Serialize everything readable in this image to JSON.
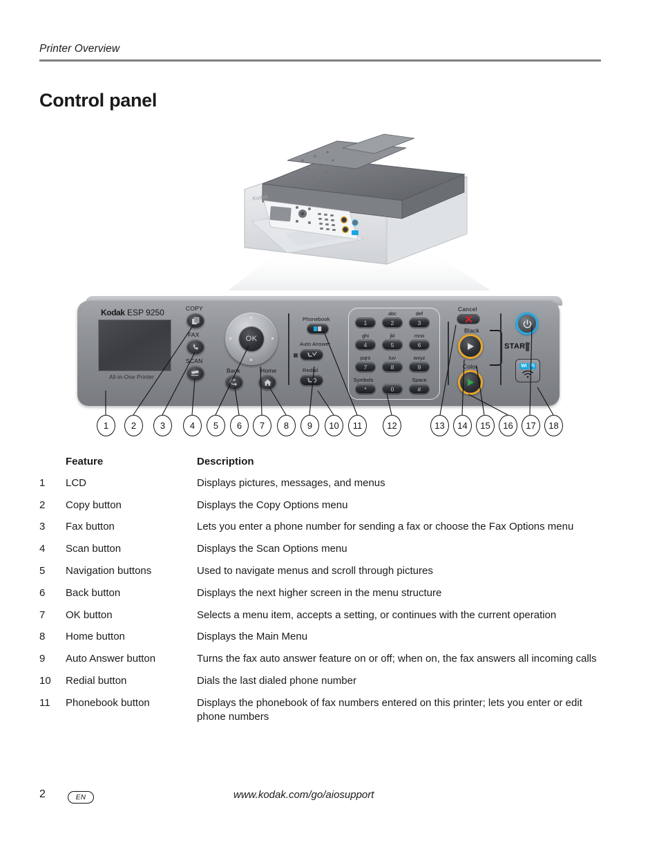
{
  "header": {
    "running_head": "Printer Overview",
    "title": "Control panel"
  },
  "figure": {
    "alt_name": "kodak-esp-9250-control-panel-diagram",
    "panel": {
      "brand_primary": "Kodak",
      "brand_model": "ESP 9250",
      "lcd_caption": "All-in-One Printer",
      "labels": {
        "copy": "COPY",
        "fax": "FAX",
        "scan": "SCAN",
        "back": "Back",
        "home": "Home",
        "ok": "OK",
        "phonebook": "Phonebook",
        "auto_answer": "Auto Answer",
        "redial": "Redial",
        "cancel": "Cancel",
        "black": "Black",
        "color": "Color",
        "start": "START",
        "wifi": [
          "Wi",
          "Fi"
        ]
      },
      "keypad": [
        {
          "digit": "1",
          "letters": ""
        },
        {
          "digit": "2",
          "letters": "abc"
        },
        {
          "digit": "3",
          "letters": "def"
        },
        {
          "digit": "4",
          "letters": "ghi"
        },
        {
          "digit": "5",
          "letters": "jkl"
        },
        {
          "digit": "6",
          "letters": "mno"
        },
        {
          "digit": "7",
          "letters": "pqrs"
        },
        {
          "digit": "8",
          "letters": "tuv"
        },
        {
          "digit": "9",
          "letters": "wxyz"
        },
        {
          "digit": "*",
          "letters": "Symbols"
        },
        {
          "digit": "0",
          "letters": ""
        },
        {
          "digit": "#",
          "letters": "Space"
        }
      ],
      "callouts": [
        "1",
        "2",
        "3",
        "4",
        "5",
        "6",
        "7",
        "8",
        "9",
        "10",
        "11",
        "12",
        "13",
        "14",
        "15",
        "16",
        "17",
        "18"
      ]
    },
    "colors": {
      "panel_body": "#93969b",
      "start_ring": "#e8a72c",
      "power_ring": "#2aa8e0",
      "wifi_badge": "#19a8e0",
      "cancel_x": "#d0262a",
      "color_triangle": "#2fa84f"
    }
  },
  "table": {
    "headers": {
      "num": "",
      "feature": "Feature",
      "description": "Description"
    },
    "rows": [
      {
        "num": "1",
        "feature": "LCD",
        "description": "Displays pictures, messages, and menus"
      },
      {
        "num": "2",
        "feature": "Copy button",
        "description": "Displays the Copy Options menu"
      },
      {
        "num": "3",
        "feature": "Fax button",
        "description": "Lets you enter a phone number for sending a fax or choose the Fax Options menu"
      },
      {
        "num": "4",
        "feature": "Scan button",
        "description": "Displays the Scan Options menu"
      },
      {
        "num": "5",
        "feature": "Navigation buttons",
        "description": "Used to navigate menus and scroll through pictures"
      },
      {
        "num": "6",
        "feature": "Back button",
        "description": "Displays the next higher screen in the menu structure"
      },
      {
        "num": "7",
        "feature": "OK button",
        "description": "Selects a menu item, accepts a setting, or continues with the current operation"
      },
      {
        "num": "8",
        "feature": "Home button",
        "description": "Displays the Main Menu"
      },
      {
        "num": "9",
        "feature": "Auto Answer button",
        "description": "Turns the fax auto answer feature on or off; when on, the fax answers all incoming calls"
      },
      {
        "num": "10",
        "feature": "Redial button",
        "description": "Dials the last dialed phone number"
      },
      {
        "num": "11",
        "feature": "Phonebook button",
        "description": "Displays the phonebook of fax numbers entered on this printer; lets you enter or edit phone numbers"
      }
    ]
  },
  "footer": {
    "page_number": "2",
    "language": "EN",
    "url": "www.kodak.com/go/aiosupport"
  }
}
